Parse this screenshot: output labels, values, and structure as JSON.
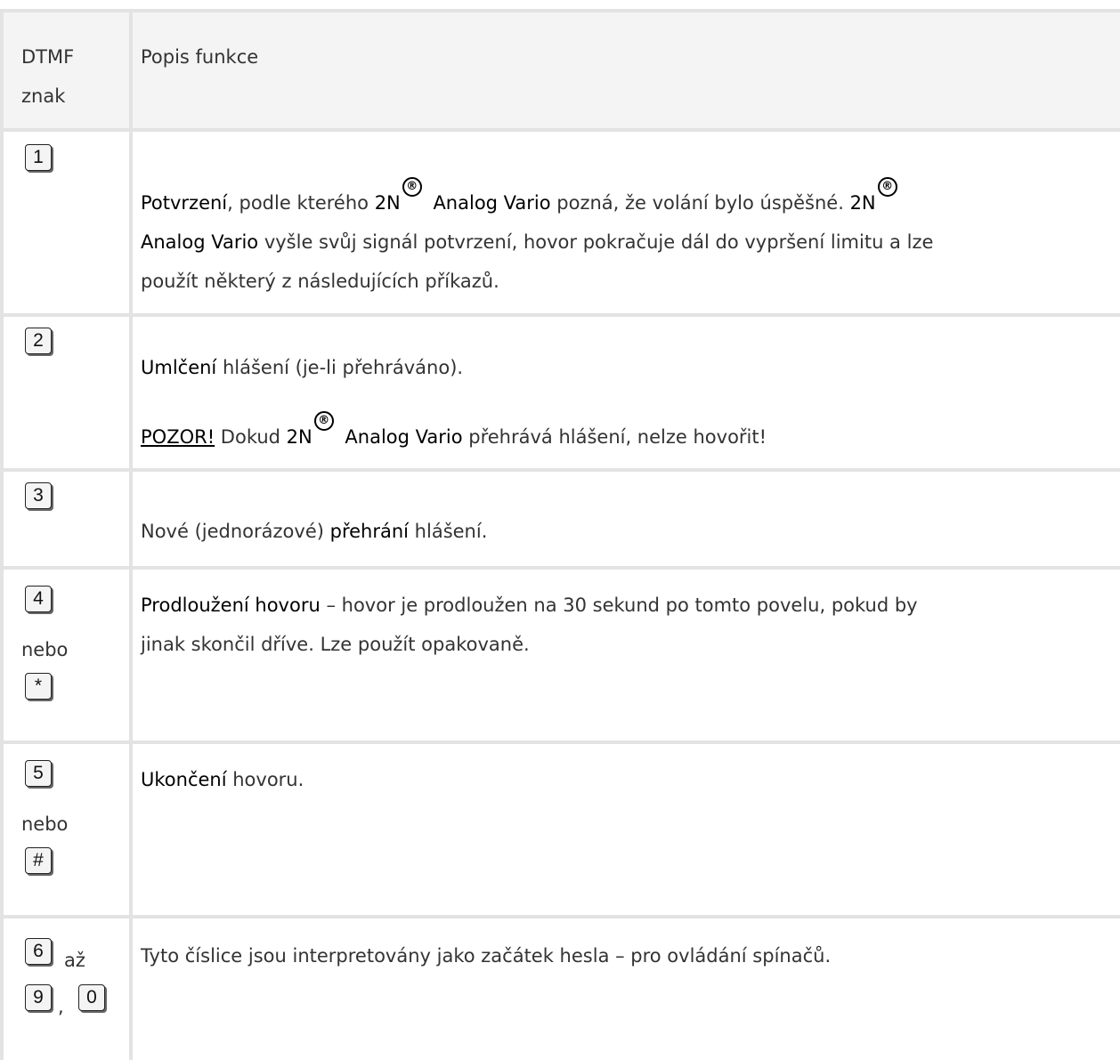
{
  "table": {
    "header": {
      "col1": [
        "DTMF",
        "znak"
      ],
      "col2": "Popis funkce"
    },
    "rows": [
      {
        "keys": [
          "1"
        ],
        "desc": {
          "t1": "Potvrzení",
          "t2": ", podle kterého ",
          "brand1": "2N",
          "reg": "®",
          "product": " Analog Vario",
          "t3": " pozná, že volání bylo úspěšné. ",
          "brand2": "2N",
          "product2": "Analog Vario",
          "t4": " vyšle svůj signál potvrzení, hovor pokračuje dál do vypršení limitu a lze",
          "t5": "použít některý z následujících příkazů."
        }
      },
      {
        "keys": [
          "2"
        ],
        "desc": {
          "t1": "Umlčení",
          "t2": " hlášení (je-li přehráváno).",
          "warn": "POZOR!",
          "t3": " Dokud ",
          "brand": "2N",
          "reg": "®",
          "product": " Analog Vario",
          "t4": " přehrává hlášení, nelze hovořit!"
        }
      },
      {
        "keys": [
          "3"
        ],
        "desc": {
          "t1": "Nové (jednorázové) ",
          "t2": "přehrání",
          "t3": " hlášení."
        }
      },
      {
        "keys": [
          "4",
          "*"
        ],
        "or": "nebo",
        "desc": {
          "t1": "Prodloužení hovoru",
          "t2": " – hovor je prodloužen na 30 sekund po tomto povelu, pokud by",
          "t3": "jinak skončil dříve. Lze použít opakovaně."
        }
      },
      {
        "keys": [
          "5",
          "#"
        ],
        "or": "nebo",
        "desc": {
          "t1": "Ukončení",
          "t2": " hovoru."
        }
      },
      {
        "keys": [
          "6",
          "9",
          "0"
        ],
        "to": "až",
        "sep": ",",
        "desc": {
          "t1": "Tyto číslice jsou interpretovány jako začátek hesla – pro ovládání spínačů."
        }
      }
    ]
  }
}
